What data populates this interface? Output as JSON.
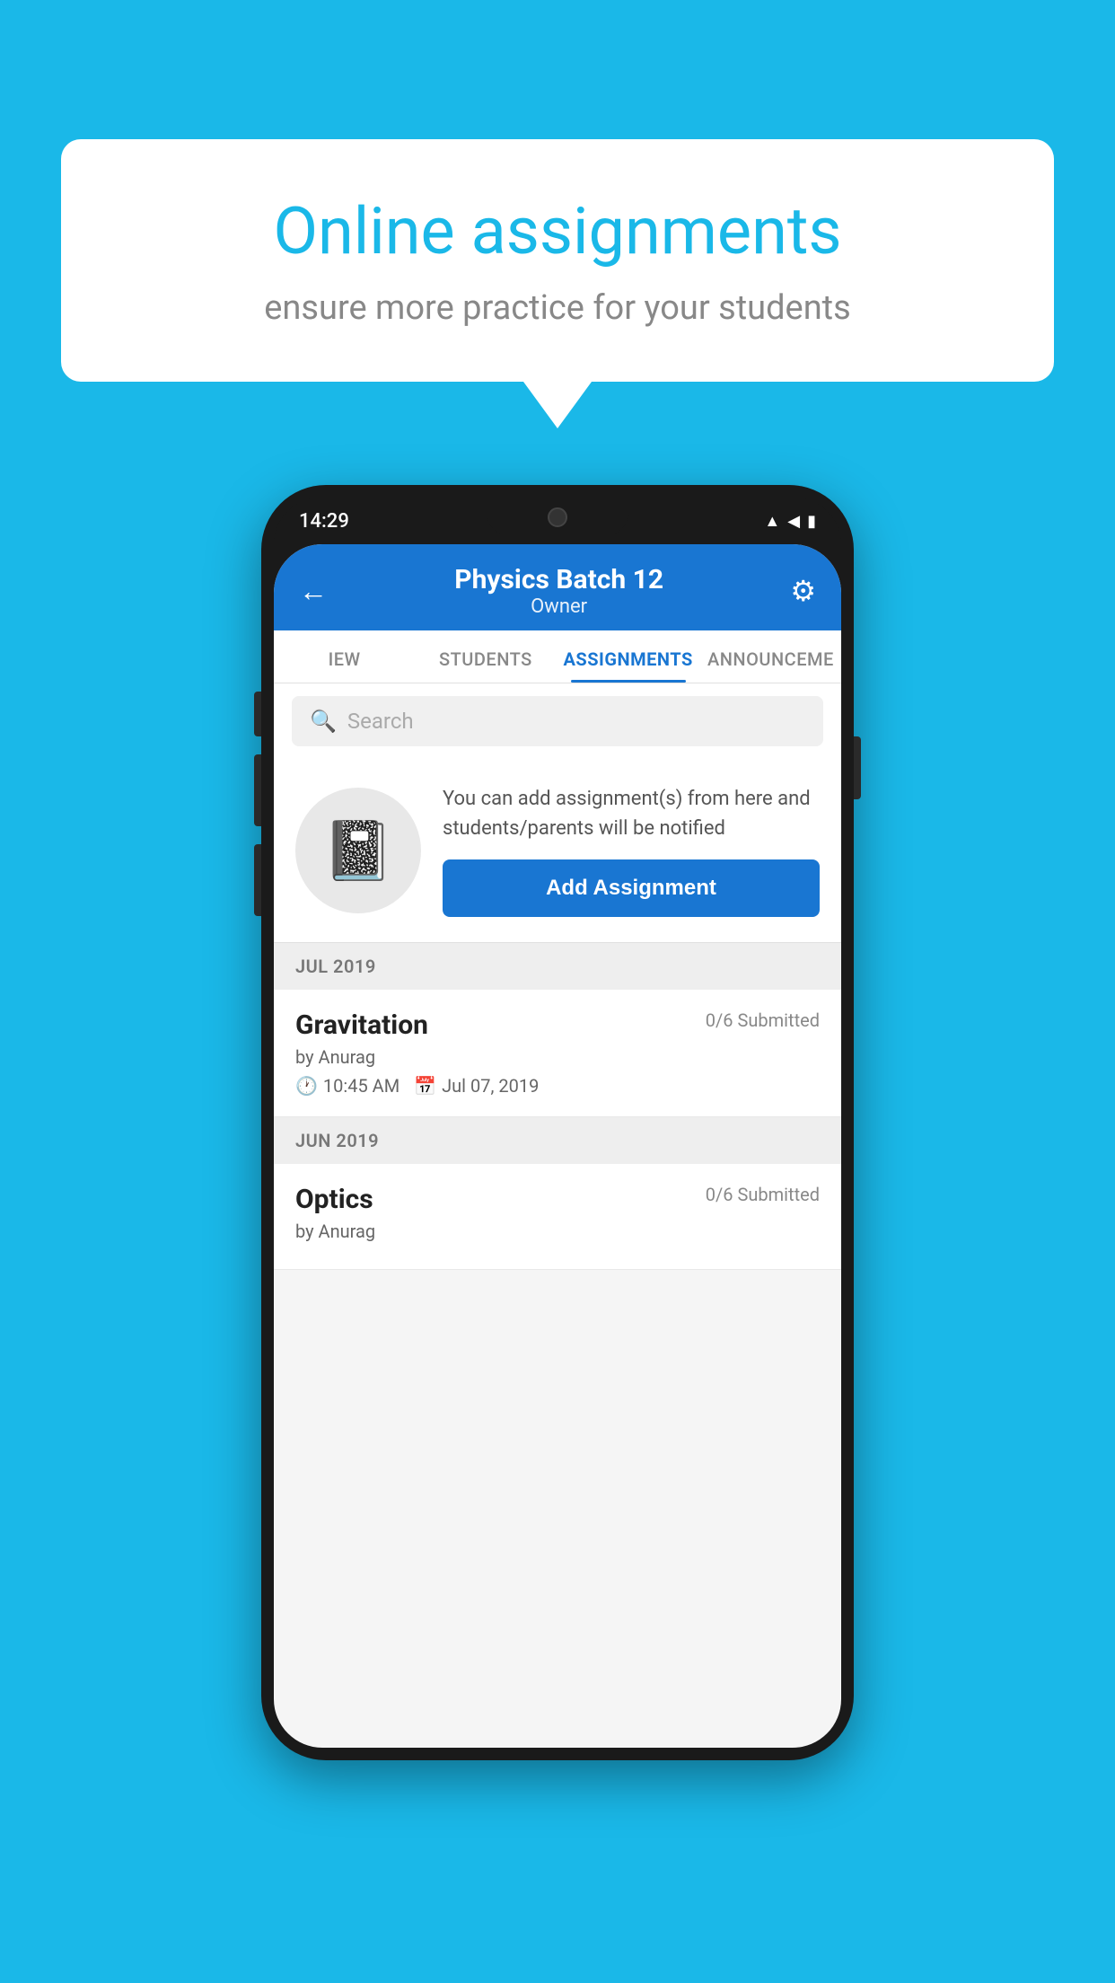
{
  "background_color": "#1ab8e8",
  "speech_bubble": {
    "title": "Online assignments",
    "subtitle": "ensure more practice for your students"
  },
  "phone": {
    "status_bar": {
      "time": "14:29"
    },
    "header": {
      "title": "Physics Batch 12",
      "subtitle": "Owner",
      "back_label": "←",
      "gear_label": "⚙"
    },
    "tabs": [
      {
        "label": "IEW",
        "active": false
      },
      {
        "label": "STUDENTS",
        "active": false
      },
      {
        "label": "ASSIGNMENTS",
        "active": true
      },
      {
        "label": "ANNOUNCEME",
        "active": false
      }
    ],
    "search": {
      "placeholder": "Search"
    },
    "add_promo": {
      "icon": "📓",
      "text": "You can add assignment(s) from here and students/parents will be notified",
      "button_label": "Add Assignment"
    },
    "sections": [
      {
        "label": "JUL 2019",
        "assignments": [
          {
            "title": "Gravitation",
            "submitted": "0/6 Submitted",
            "by": "by Anurag",
            "time": "10:45 AM",
            "date": "Jul 07, 2019"
          }
        ]
      },
      {
        "label": "JUN 2019",
        "assignments": [
          {
            "title": "Optics",
            "submitted": "0/6 Submitted",
            "by": "by Anurag",
            "time": "",
            "date": ""
          }
        ]
      }
    ]
  }
}
